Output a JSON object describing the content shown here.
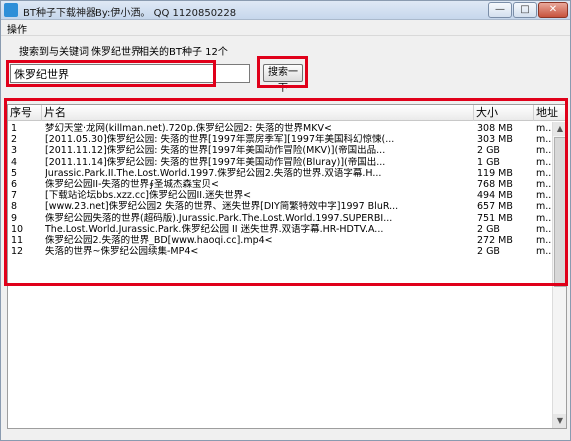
{
  "window": {
    "title": "BT种子下载神器",
    "author": "By:伊小洒。 QQ 1120850228",
    "min_glyph": "—",
    "max_glyph": "□",
    "close_glyph": "✕"
  },
  "menu": {
    "operate": "操作"
  },
  "info": {
    "keyword_label": "搜索到与关键词",
    "keyword": "侏罗纪世界",
    "count_text": "相关的BT种子 12个"
  },
  "search": {
    "value": "侏罗纪世界",
    "button": "搜索一下"
  },
  "table": {
    "headers": [
      "序号",
      "片名",
      "大小",
      "地址"
    ],
    "rows": [
      {
        "id": "1",
        "name": "梦幻天堂·龙网(killman.net).720p.侏罗纪公园2: 失落的世界MKV<",
        "size": "308 MB",
        "addr": "m..."
      },
      {
        "id": "2",
        "name": "[2011.05.30]侏罗纪公园: 失落的世界[1997年票房季军][1997年美国科幻惊悚(...",
        "size": "303 MB",
        "addr": "m..."
      },
      {
        "id": "3",
        "name": "[2011.11.12]侏罗纪公园: 失落的世界[1997年美国动作冒险(MKV)](帝国出品...",
        "size": "2 GB",
        "addr": "m..."
      },
      {
        "id": "4",
        "name": "[2011.11.14]侏罗纪公园: 失落的世界[1997年美国动作冒险(Bluray)](帝国出...",
        "size": "1 GB",
        "addr": "m..."
      },
      {
        "id": "5",
        "name": "Jurassic.Park.II.The.Lost.World.1997.侏罗纪公园2.失落的世界.双语字幕.H...",
        "size": "119 MB",
        "addr": "m..."
      },
      {
        "id": "6",
        "name": "侏罗纪公园II-失落的世界∮圣城杰森宝贝<",
        "size": "768 MB",
        "addr": "m..."
      },
      {
        "id": "7",
        "name": "[下载站论坛bbs.xzz.cc]侏罗纪公园II.迷失世界<",
        "size": "494 MB",
        "addr": "m..."
      },
      {
        "id": "8",
        "name": "[www.23.net]侏罗纪公园2 失落的世界、迷失世界[DIY简繁特效中字]1997 BluR...",
        "size": "657 MB",
        "addr": "m..."
      },
      {
        "id": "9",
        "name": "侏罗纪公园失落的世界(超码版).Jurassic.Park.The.Lost.World.1997.SUPERBI...",
        "size": "751 MB",
        "addr": "m..."
      },
      {
        "id": "10",
        "name": "The.Lost.World.Jurassic.Park.侏罗纪公园 II 迷失世界.双语字幕.HR-HDTV.A...",
        "size": "2 GB",
        "addr": "m..."
      },
      {
        "id": "11",
        "name": "侏罗纪公园2.失落的世界_BD[www.haoqi.cc].mp4<",
        "size": "272 MB",
        "addr": "m..."
      },
      {
        "id": "12",
        "name": "失落的世界~侏罗纪公园续集-MP4<",
        "size": "2 GB",
        "addr": "m..."
      }
    ]
  },
  "scroll": {
    "up": "▲",
    "down": "▼"
  },
  "colors": {
    "highlight": "#e0001a",
    "title_bar": "#c6d7ec"
  }
}
